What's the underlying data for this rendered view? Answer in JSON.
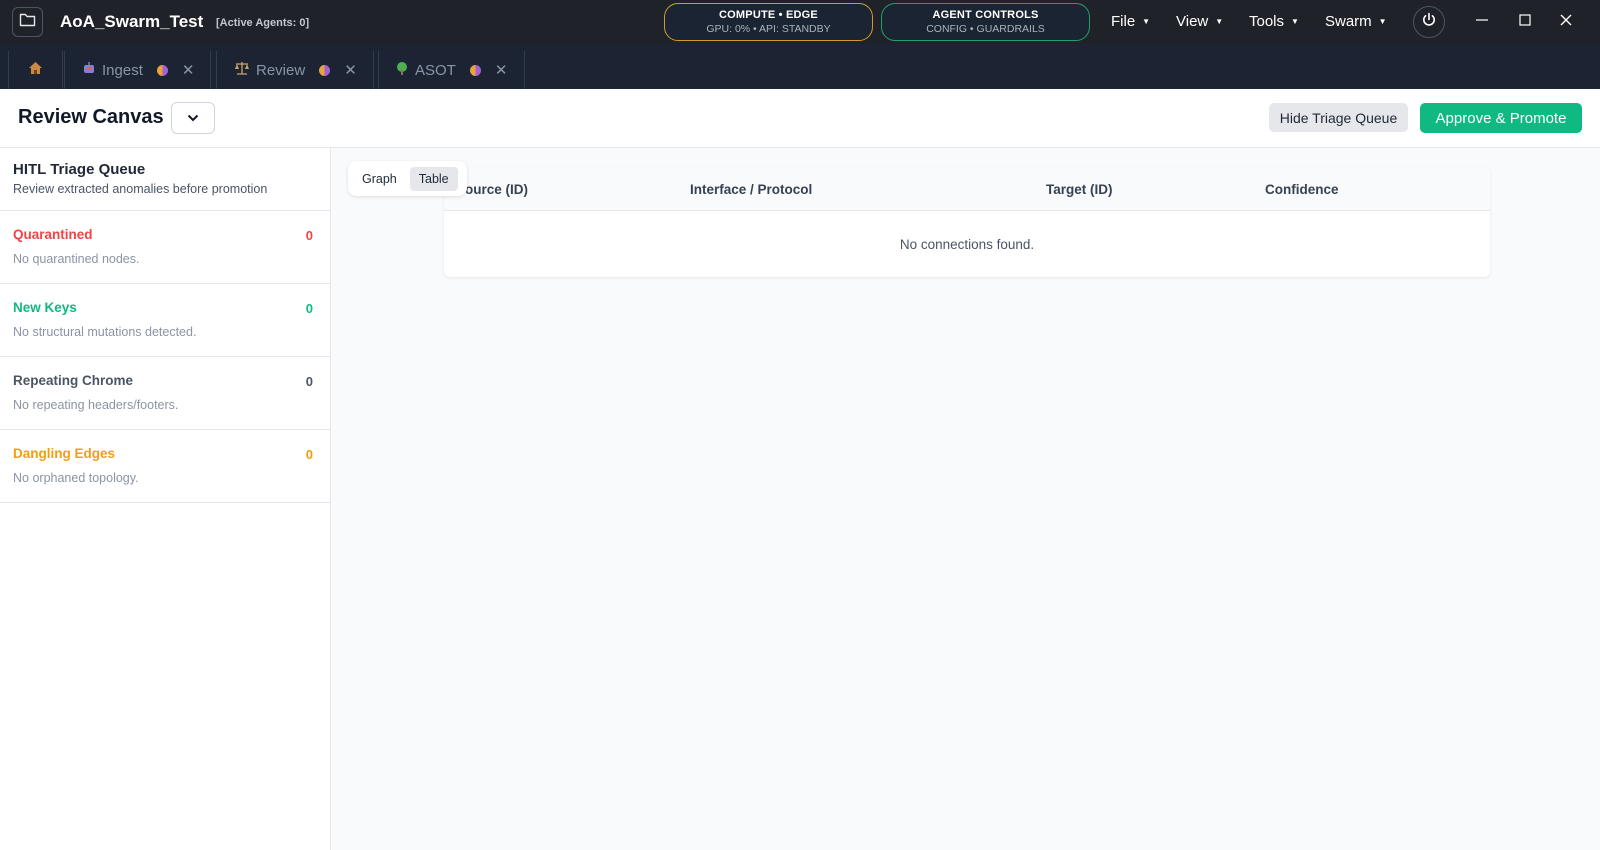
{
  "app": {
    "title": "AoA_Swarm_Test",
    "active_agents": "[Active Agents: 0]"
  },
  "status_pills": {
    "compute": {
      "title": "COMPUTE • EDGE",
      "sub": "GPU: 0% • API: STANDBY",
      "color": "#d39a2e"
    },
    "agent_controls": {
      "title": "AGENT CONTROLS",
      "sub": "CONFIG • GUARDRAILS",
      "color": "#1fa06b"
    }
  },
  "menus": [
    "File",
    "View",
    "Tools",
    "Swarm"
  ],
  "tabs": [
    {
      "label": "Ingest",
      "icon": "robot-icon"
    },
    {
      "label": "Review",
      "icon": "scales-icon"
    },
    {
      "label": "ASOT",
      "icon": "tree-icon"
    }
  ],
  "header": {
    "title": "Review Canvas",
    "select_value": "",
    "hide_button": "Hide Triage Queue",
    "approve_button": "Approve & Promote"
  },
  "sidebar": {
    "title": "HITL Triage Queue",
    "subtitle": "Review extracted anomalies before promotion",
    "items": [
      {
        "label": "Quarantined",
        "count": "0",
        "desc": "No quarantined nodes.",
        "color": "#ef4444"
      },
      {
        "label": "New Keys",
        "count": "0",
        "desc": "No structural mutations detected.",
        "color": "#10b981"
      },
      {
        "label": "Repeating Chrome",
        "count": "0",
        "desc": "No repeating headers/footers.",
        "color": "#4b5563"
      },
      {
        "label": "Dangling Edges",
        "count": "0",
        "desc": "No orphaned topology.",
        "color": "#f59e0b"
      }
    ]
  },
  "view_toggle": {
    "graph": "Graph",
    "table": "Table",
    "active": "Table"
  },
  "table": {
    "columns": [
      "ource (ID)",
      "Interface / Protocol",
      "Target (ID)",
      "Confidence"
    ],
    "empty": "No connections found."
  }
}
